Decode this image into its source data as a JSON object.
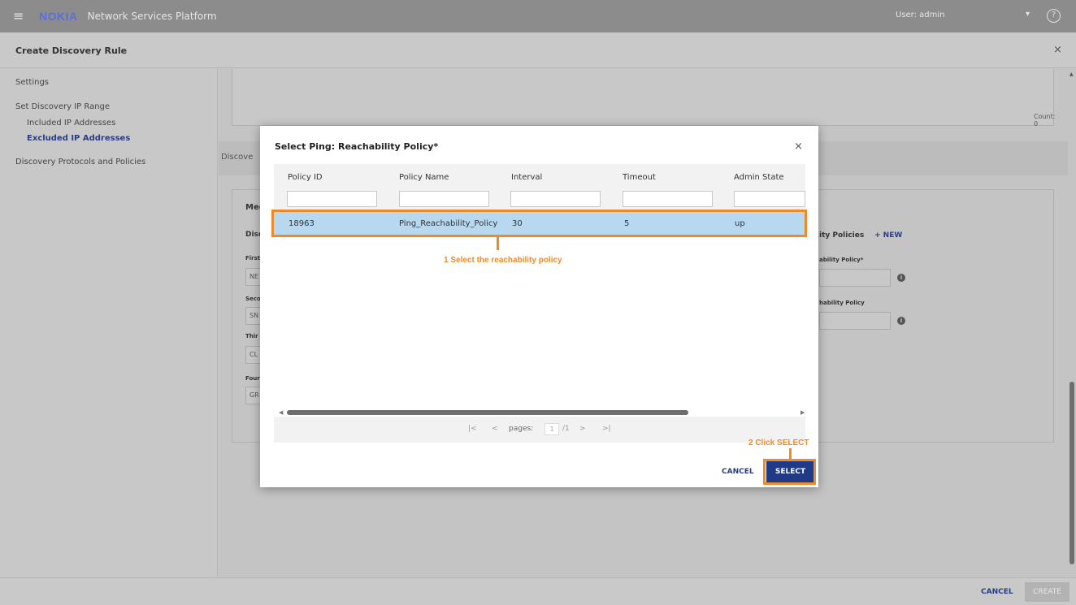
{
  "topbar": {
    "menu_icon": "hamburger-icon",
    "logo": "NOKIA",
    "app_name": "Network Services Platform",
    "user": "User: admin",
    "user_caret": "▾",
    "help": "?"
  },
  "page": {
    "title": "Create Discovery Rule",
    "close": "×"
  },
  "nav": {
    "settings": "Settings",
    "set_range": "Set Discovery IP Range",
    "included": "Included IP Addresses",
    "excluded": "Excluded IP Addresses",
    "protocols": "Discovery Protocols and Policies"
  },
  "background": {
    "count": "Count: 0",
    "discover_title": "Discove",
    "card_title": "Mec",
    "disc_frag": "Disc",
    "first": "First",
    "first_val": "NE",
    "second": "Seco",
    "second_val": "SN",
    "third": "Thir",
    "third_val": "CL",
    "fourth": "Four",
    "fourth_val": "GR",
    "policies_frag": "ity Policies",
    "new_link": "+ NEW",
    "reach_policy_frag": "ability Policy*",
    "reach_policy2_frag": "hability Policy"
  },
  "footer": {
    "cancel": "CANCEL",
    "create": "CREATE"
  },
  "modal": {
    "title": "Select Ping: Reachability Policy*",
    "close": "×",
    "columns": [
      "Policy ID",
      "Policy Name",
      "Interval",
      "Timeout",
      "Admin State"
    ],
    "rows": [
      {
        "policy_id": "18963",
        "policy_name": "Ping_Reachability_Policy",
        "interval": "30",
        "timeout": "5",
        "admin_state": "up"
      }
    ],
    "pager": {
      "first": "|<",
      "prev": "<",
      "label": "pages:",
      "current": "1",
      "total": "/1",
      "next": ">",
      "last": ">|"
    },
    "cancel": "CANCEL",
    "select": "SELECT"
  },
  "annotations": {
    "step1": "1 Select the reachability policy",
    "step2": "2 Click SELECT",
    "accent_color": "#ef8a2b"
  }
}
